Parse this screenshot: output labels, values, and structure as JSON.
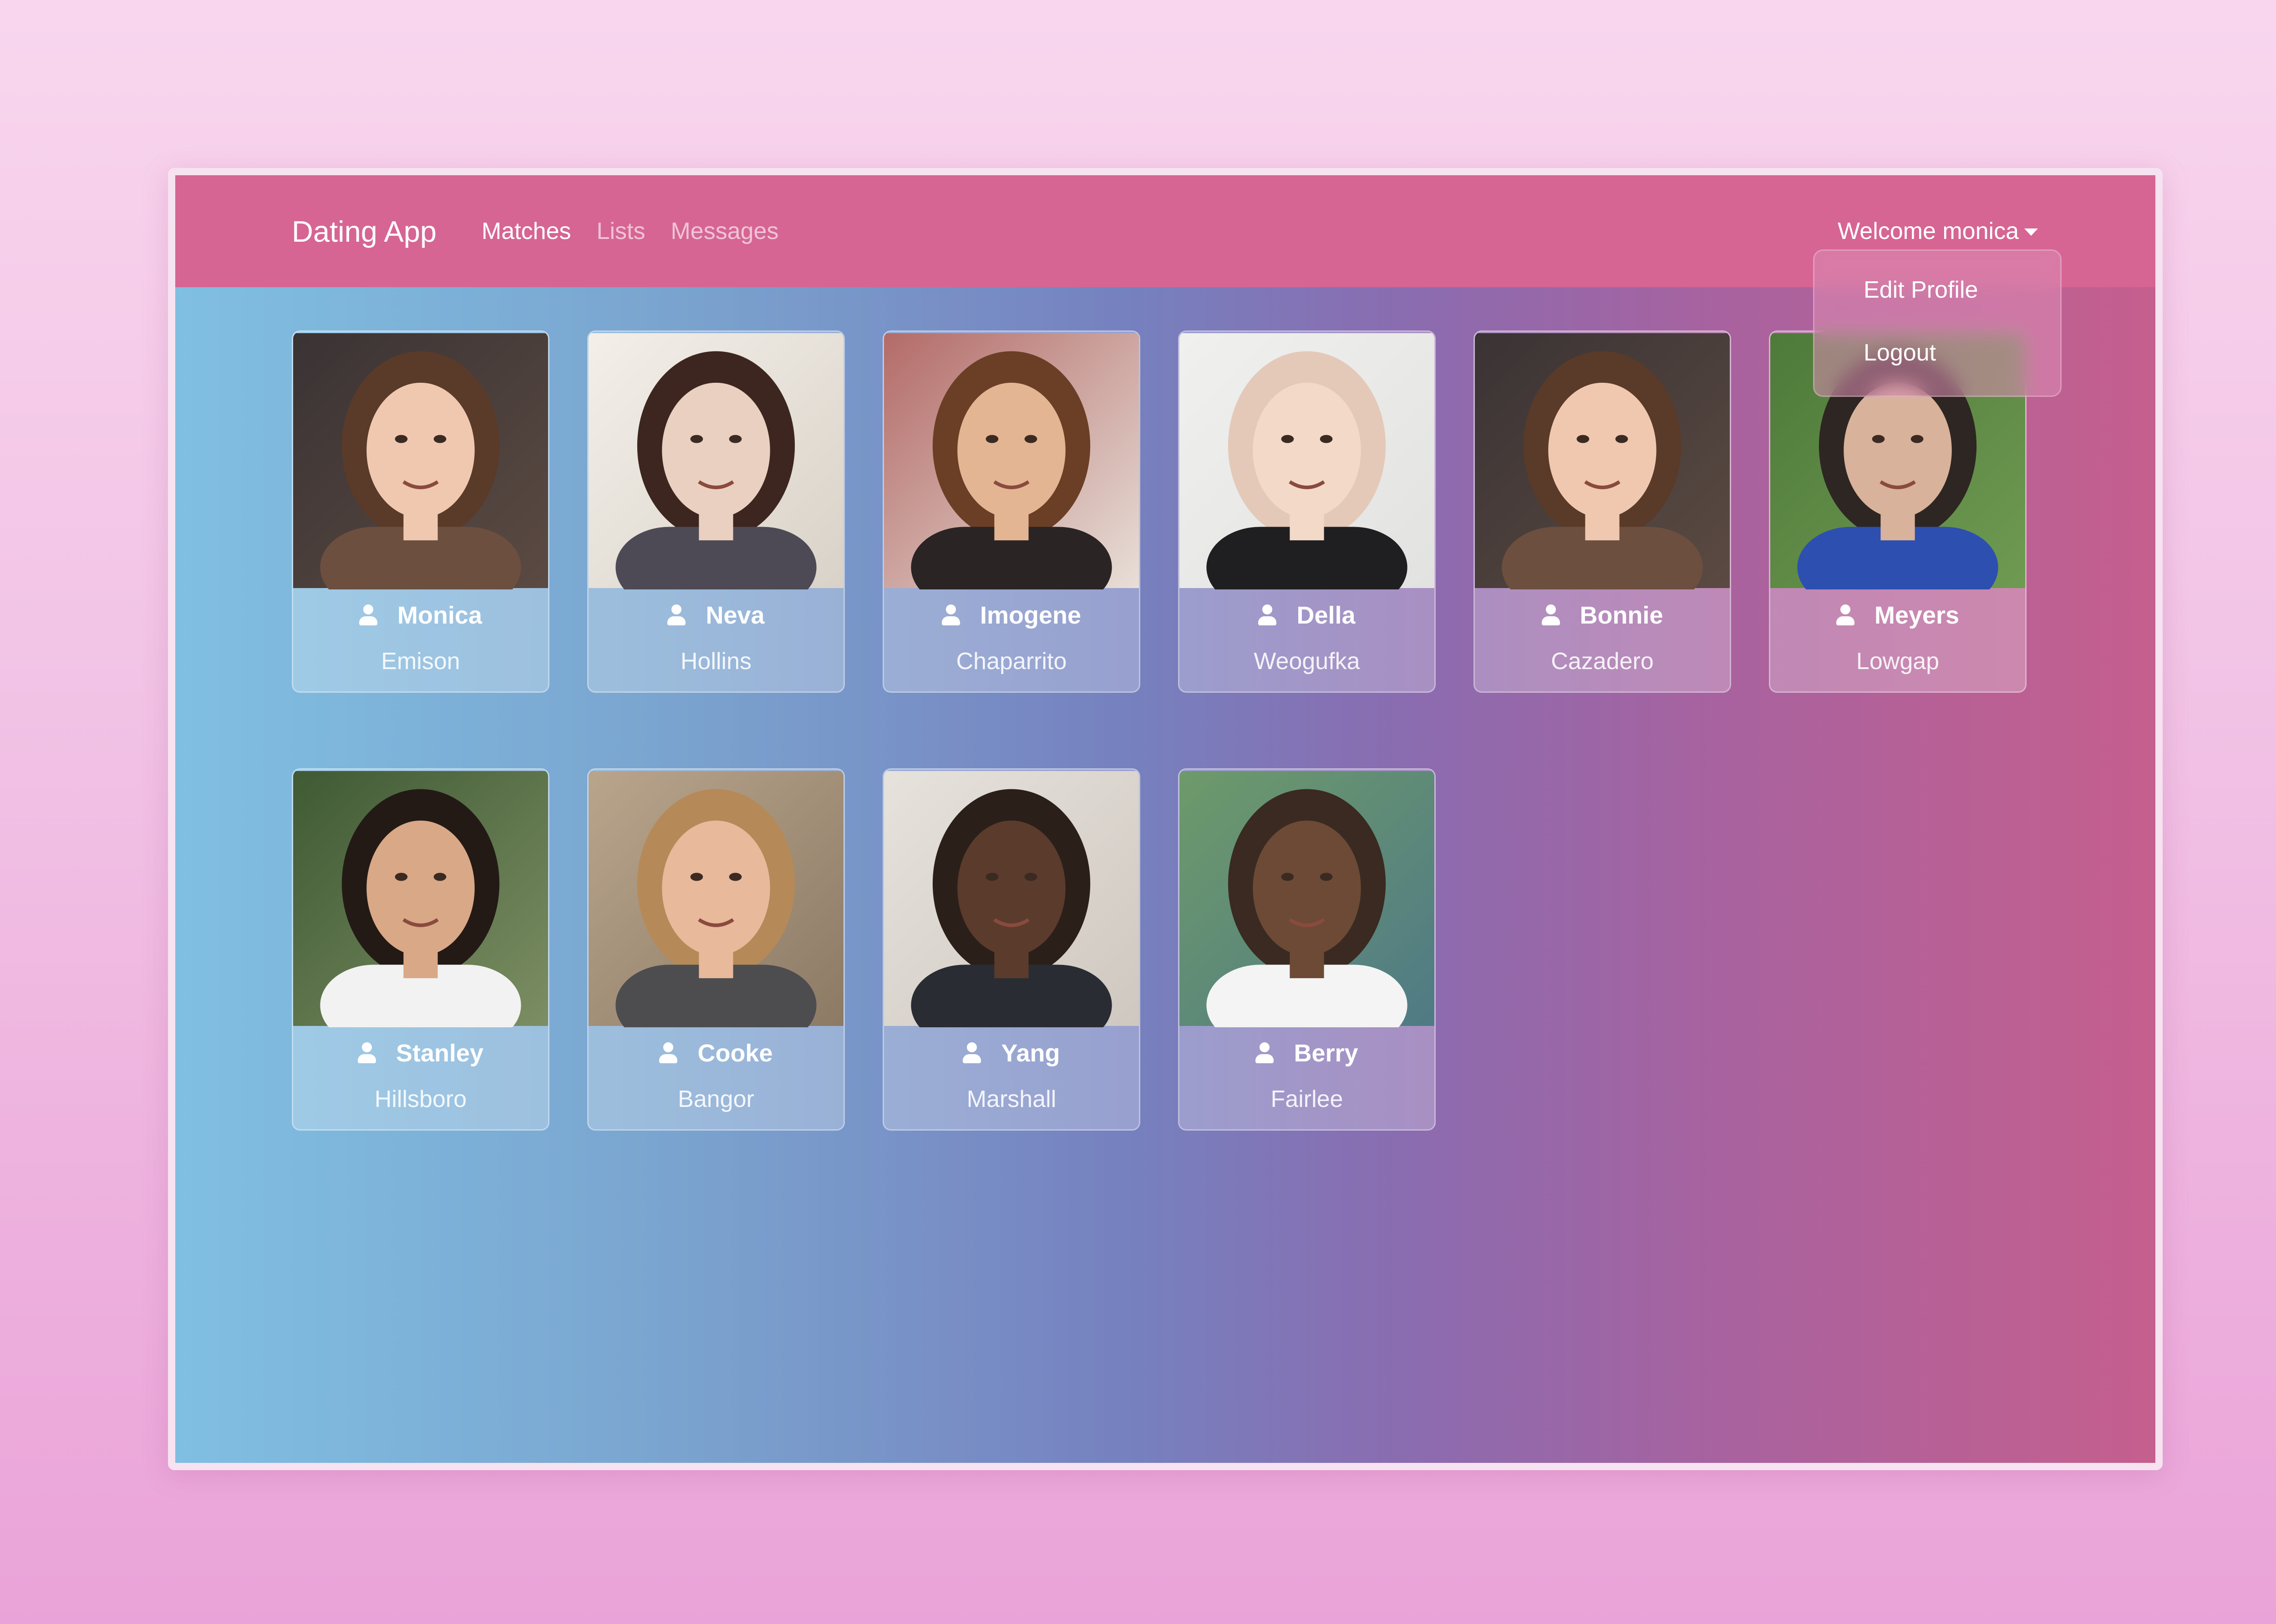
{
  "navbar": {
    "brand": "Dating App",
    "links": [
      "Matches",
      "Lists",
      "Messages"
    ],
    "welcome": "Welcome monica"
  },
  "dropdown": {
    "items": [
      "Edit Profile",
      "Logout"
    ]
  },
  "members": [
    {
      "name": "Monica",
      "city": "Emison",
      "photo": "woman-brunette-smiling"
    },
    {
      "name": "Neva",
      "city": "Hollins",
      "photo": "woman-brunette-jacket"
    },
    {
      "name": "Imogene",
      "city": "Chaparrito",
      "photo": "woman-long-brown-hair"
    },
    {
      "name": "Della",
      "city": "Weogufka",
      "photo": "woman-blonde-black-top"
    },
    {
      "name": "Bonnie",
      "city": "Cazadero",
      "photo": "woman-brunette-smiling"
    },
    {
      "name": "Meyers",
      "city": "Lowgap",
      "photo": "man-blue-shirt-outdoor"
    },
    {
      "name": "Stanley",
      "city": "Hillsboro",
      "photo": "man-dark-hair-white-tee"
    },
    {
      "name": "Cooke",
      "city": "Bangor",
      "photo": "man-grey-tee-building"
    },
    {
      "name": "Yang",
      "city": "Marshall",
      "photo": "man-suit-tie"
    },
    {
      "name": "Berry",
      "city": "Fairlee",
      "photo": "man-glasses-white-shirt"
    }
  ],
  "colors": {
    "navbar": "#d66594",
    "gradient_left": "#80bfe2",
    "gradient_right": "#c55f8e"
  }
}
